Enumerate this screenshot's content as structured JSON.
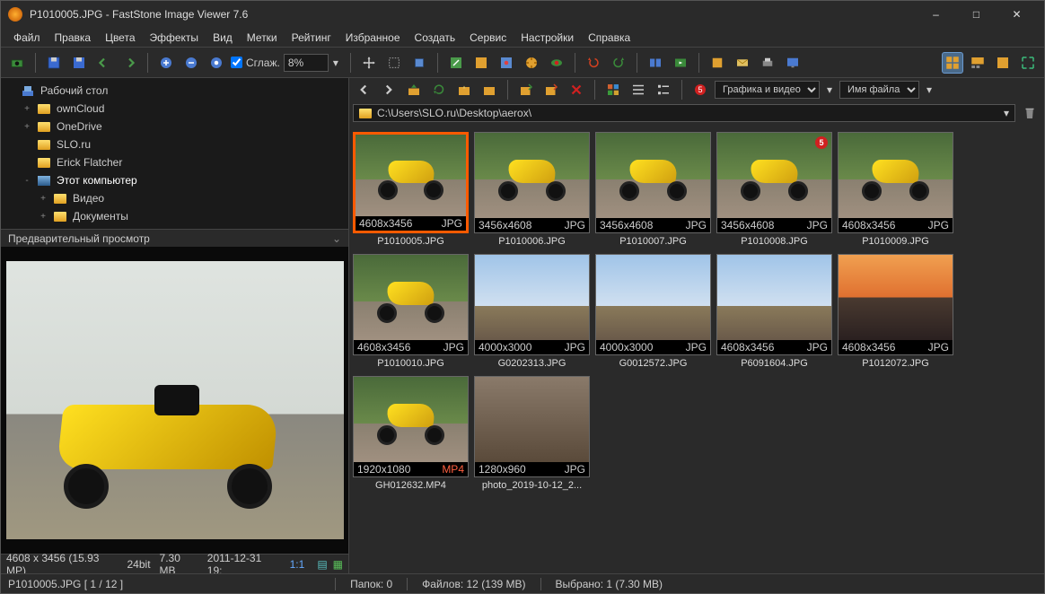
{
  "title": "P1010005.JPG  -  FastStone Image Viewer 7.6",
  "menu": [
    "Файл",
    "Правка",
    "Цвета",
    "Эффекты",
    "Вид",
    "Метки",
    "Рейтинг",
    "Избранное",
    "Создать",
    "Сервис",
    "Настройки",
    "Справка"
  ],
  "smooth_label": "Сглаж.",
  "zoom_value": "8%",
  "tree": {
    "root": "Рабочий стол",
    "items": [
      {
        "exp": "+",
        "label": "ownCloud",
        "indent": 1
      },
      {
        "exp": "+",
        "label": "OneDrive",
        "indent": 1
      },
      {
        "exp": "",
        "label": "SLO.ru",
        "indent": 1
      },
      {
        "exp": "",
        "label": "Erick Flatcher",
        "indent": 1
      },
      {
        "exp": "-",
        "label": "Этот компьютер",
        "indent": 1,
        "hl": true
      },
      {
        "exp": "+",
        "label": "Видео",
        "indent": 2
      },
      {
        "exp": "+",
        "label": "Документы",
        "indent": 2
      }
    ]
  },
  "preview_header": "Предварительный просмотр",
  "info": {
    "dim": "4608 x 3456 (15.93 MP)",
    "depth": "24bit",
    "size": "7.30 MB",
    "date": "2011-12-31 19:",
    "ratio": "1:1"
  },
  "nav": {
    "filter_label": "Графика и видео",
    "sort_label": "Имя файла"
  },
  "address": "C:\\Users\\SLO.ru\\Desktop\\aerox\\",
  "thumbs": [
    {
      "name": "P1010005.JPG",
      "dim": "4608x3456",
      "ext": "JPG",
      "sel": true,
      "cls": "green"
    },
    {
      "name": "P1010006.JPG",
      "dim": "3456x4608",
      "ext": "JPG",
      "cls": "green"
    },
    {
      "name": "P1010007.JPG",
      "dim": "3456x4608",
      "ext": "JPG",
      "cls": "green"
    },
    {
      "name": "P1010008.JPG",
      "dim": "3456x4608",
      "ext": "JPG",
      "badge": "5",
      "cls": "green"
    },
    {
      "name": "P1010009.JPG",
      "dim": "4608x3456",
      "ext": "JPG",
      "cls": "green"
    },
    {
      "name": "P1010010.JPG",
      "dim": "4608x3456",
      "ext": "JPG",
      "cls": "green"
    },
    {
      "name": "G0202313.JPG",
      "dim": "4000x3000",
      "ext": "JPG",
      "cls": "sky"
    },
    {
      "name": "G0012572.JPG",
      "dim": "4000x3000",
      "ext": "JPG",
      "cls": "sky"
    },
    {
      "name": "P6091604.JPG",
      "dim": "4608x3456",
      "ext": "JPG",
      "cls": "sky"
    },
    {
      "name": "P1012072.JPG",
      "dim": "4608x3456",
      "ext": "JPG",
      "cls": "sunset"
    },
    {
      "name": "GH012632.MP4",
      "dim": "1920x1080",
      "ext": "MP4",
      "cls": "green",
      "mp4": true
    },
    {
      "name": "photo_2019-10-12_2...",
      "dim": "1280x960",
      "ext": "JPG",
      "cls": "indoor"
    }
  ],
  "status": {
    "file": "P1010005.JPG [ 1 / 12 ]",
    "folders": "Папок: 0",
    "files": "Файлов: 12 (139 MB)",
    "selected": "Выбрано: 1 (7.30 MB)"
  }
}
